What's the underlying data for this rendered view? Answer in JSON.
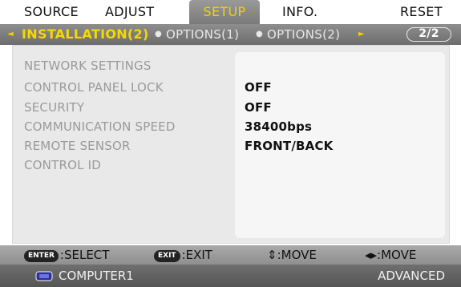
{
  "tabs": {
    "source": "SOURCE",
    "adjust": "ADJUST",
    "setup": "SETUP",
    "info": "INFO.",
    "reset": "RESET"
  },
  "subtabs": {
    "left_arrow": "◄",
    "active": "INSTALLATION(2)",
    "bullet": "●",
    "options1": "OPTIONS(1)",
    "options2": "OPTIONS(2)",
    "right_arrow": "►",
    "page": "2/2"
  },
  "settings": [
    {
      "label": "NETWORK SETTINGS",
      "value": ""
    },
    {
      "label": "CONTROL PANEL LOCK",
      "value": "OFF"
    },
    {
      "label": "SECURITY",
      "value": "OFF"
    },
    {
      "label": "COMMUNICATION SPEED",
      "value": "38400bps"
    },
    {
      "label": "REMOTE SENSOR",
      "value": "FRONT/BACK"
    },
    {
      "label": "CONTROL ID",
      "value": ""
    }
  ],
  "help": {
    "enter_key": "ENTER",
    "enter_label": ":SELECT",
    "exit_key": "EXIT",
    "exit_label": ":EXIT",
    "move_vertical": "⇕:MOVE",
    "move_horizontal": "◂▸:MOVE"
  },
  "status": {
    "source_icon": "computer-icon",
    "source": "COMPUTER1",
    "mode": "ADVANCED"
  },
  "colors": {
    "active_tab_text": "#f2d100",
    "bar": "#7a7a7a"
  }
}
